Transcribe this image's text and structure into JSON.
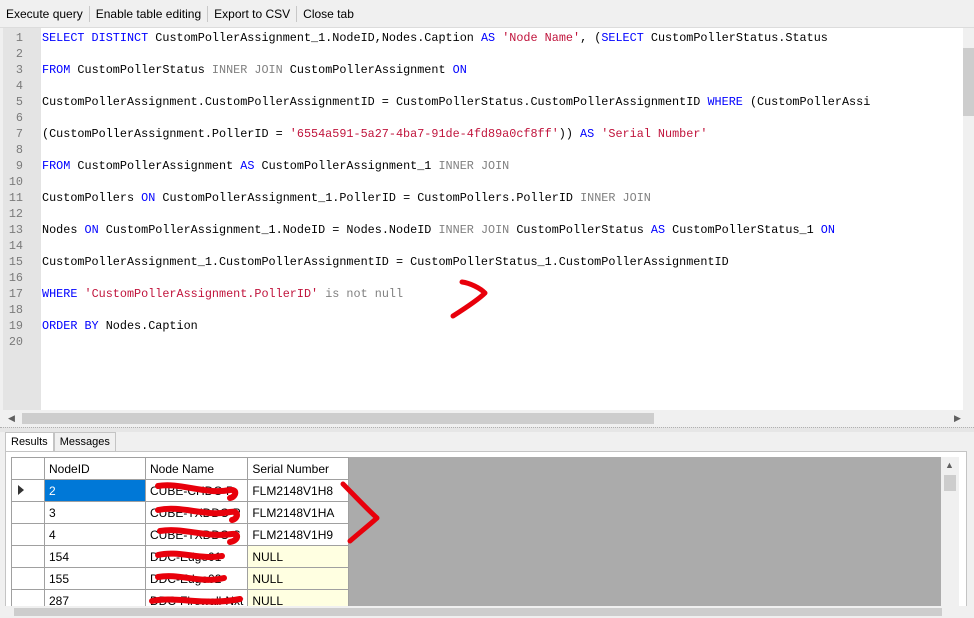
{
  "toolbar": {
    "items": [
      "Execute query",
      "Enable table editing",
      "Export to CSV",
      "Close tab"
    ]
  },
  "editor": {
    "line_numbers": [
      "1",
      "2",
      "3",
      "4",
      "5",
      "6",
      "7",
      "8",
      "9",
      "10",
      "11",
      "12",
      "13",
      "14",
      "15",
      "16",
      "17",
      "18",
      "19",
      "20"
    ],
    "lines": [
      [
        [
          "kw",
          "SELECT DISTINCT "
        ],
        [
          "id",
          "CustomPollerAssignment_1.NodeID,Nodes.Caption "
        ],
        [
          "kw",
          "AS "
        ],
        [
          "st",
          "'Node Name'"
        ],
        [
          "id",
          ", ("
        ],
        [
          "kw",
          "SELECT "
        ],
        [
          "id",
          "CustomPollerStatus.Status"
        ]
      ],
      [],
      [
        [
          "kw",
          "FROM "
        ],
        [
          "id",
          "CustomPollerStatus "
        ],
        [
          "gr",
          "INNER JOIN "
        ],
        [
          "id",
          "CustomPollerAssignment "
        ],
        [
          "kw",
          "ON"
        ]
      ],
      [],
      [
        [
          "id",
          "CustomPollerAssignment.CustomPollerAssignmentID = CustomPollerStatus.CustomPollerAssignmentID "
        ],
        [
          "kw",
          "WHERE "
        ],
        [
          "id",
          "(CustomPollerAssi"
        ]
      ],
      [],
      [
        [
          "id",
          "(CustomPollerAssignment.PollerID = "
        ],
        [
          "st",
          "'6554a591-5a27-4ba7-91de-4fd89a0cf8ff'"
        ],
        [
          "id",
          ")) "
        ],
        [
          "kw",
          "AS "
        ],
        [
          "st",
          "'Serial Number'"
        ]
      ],
      [],
      [
        [
          "kw",
          "FROM "
        ],
        [
          "id",
          "CustomPollerAssignment "
        ],
        [
          "kw",
          "AS "
        ],
        [
          "id",
          "CustomPollerAssignment_1 "
        ],
        [
          "gr",
          "INNER JOIN"
        ]
      ],
      [],
      [
        [
          "id",
          "CustomPollers "
        ],
        [
          "kw",
          "ON "
        ],
        [
          "id",
          "CustomPollerAssignment_1.PollerID = CustomPollers.PollerID "
        ],
        [
          "gr",
          "INNER JOIN"
        ]
      ],
      [],
      [
        [
          "id",
          "Nodes "
        ],
        [
          "kw",
          "ON "
        ],
        [
          "id",
          "CustomPollerAssignment_1.NodeID = Nodes.NodeID "
        ],
        [
          "gr",
          "INNER JOIN "
        ],
        [
          "id",
          "CustomPollerStatus "
        ],
        [
          "kw",
          "AS "
        ],
        [
          "id",
          "CustomPollerStatus_1 "
        ],
        [
          "kw",
          "ON"
        ]
      ],
      [],
      [
        [
          "id",
          "CustomPollerAssignment_1.CustomPollerAssignmentID = CustomPollerStatus_1.CustomPollerAssignmentID"
        ]
      ],
      [],
      [
        [
          "kw",
          "WHERE "
        ],
        [
          "st",
          "'CustomPollerAssignment.PollerID'"
        ],
        [
          "gr",
          " is not null"
        ]
      ],
      [],
      [
        [
          "kw",
          "ORDER BY "
        ],
        [
          "id",
          "Nodes.Caption"
        ]
      ],
      []
    ]
  },
  "tabs": [
    "Results",
    "Messages"
  ],
  "results": {
    "columns": [
      "NodeID",
      "Node Name",
      "Serial Number"
    ],
    "rows": [
      [
        "2",
        "CUBE-CHDC-P",
        "FLM2148V1H8"
      ],
      [
        "3",
        "CUBE-TXDDC-P",
        "FLM2148V1HA"
      ],
      [
        "4",
        "CUBE-TXDDC-S",
        "FLM2148V1H9"
      ],
      [
        "154",
        "DDC-Edge01",
        "NULL"
      ],
      [
        "155",
        "DDC-Edge02",
        "NULL"
      ],
      [
        "287",
        "DDC-Firewall-Nxt",
        "NULL"
      ]
    ]
  },
  "colors": {
    "keyword": "#0000ff",
    "string": "#c0143c",
    "operator": "#808080",
    "selection": "#0078d7",
    "null_cell": "#ffffe1",
    "annotation": "#e8000b"
  }
}
